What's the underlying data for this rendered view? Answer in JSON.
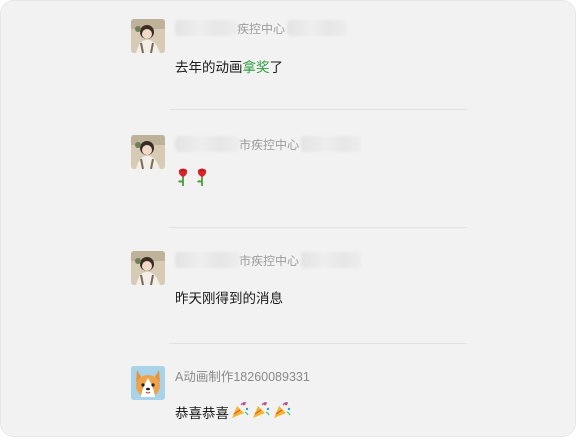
{
  "comments": [
    {
      "author_suffix": "疾控中心",
      "content_prefix": "去年的动画",
      "content_link": "拿奖",
      "content_suffix": "了"
    },
    {
      "author_suffix": "市疾控中心",
      "content_emojis": [
        "rose-emoji",
        "rose-emoji"
      ]
    },
    {
      "author_suffix": "市疾控中心",
      "content": "昨天刚得到的消息"
    },
    {
      "author": "A动画制作18260089331",
      "content": "恭喜恭喜",
      "content_emojis": [
        "party-popper-emoji",
        "party-popper-emoji",
        "party-popper-emoji"
      ]
    }
  ],
  "colors": {
    "background": "#f2f2f2",
    "link": "#2b9b3b",
    "author_text": "#8c8c8c",
    "content_text": "#1a1a1a"
  },
  "avatars": [
    "girl-photo-avatar",
    "girl-photo-avatar",
    "girl-photo-avatar",
    "corgi-dog-avatar"
  ]
}
